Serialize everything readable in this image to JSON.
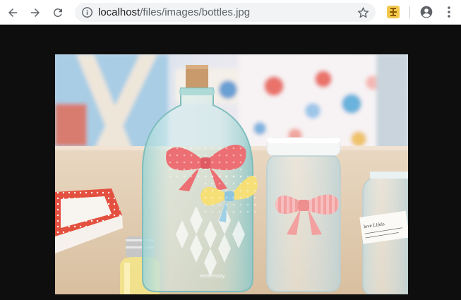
{
  "browser": {
    "url_host": "localhost",
    "url_path": "/files/images/bottles.jpg"
  },
  "image": {
    "bottle_text": "wednesday",
    "note_text": "leve Lifeis"
  }
}
